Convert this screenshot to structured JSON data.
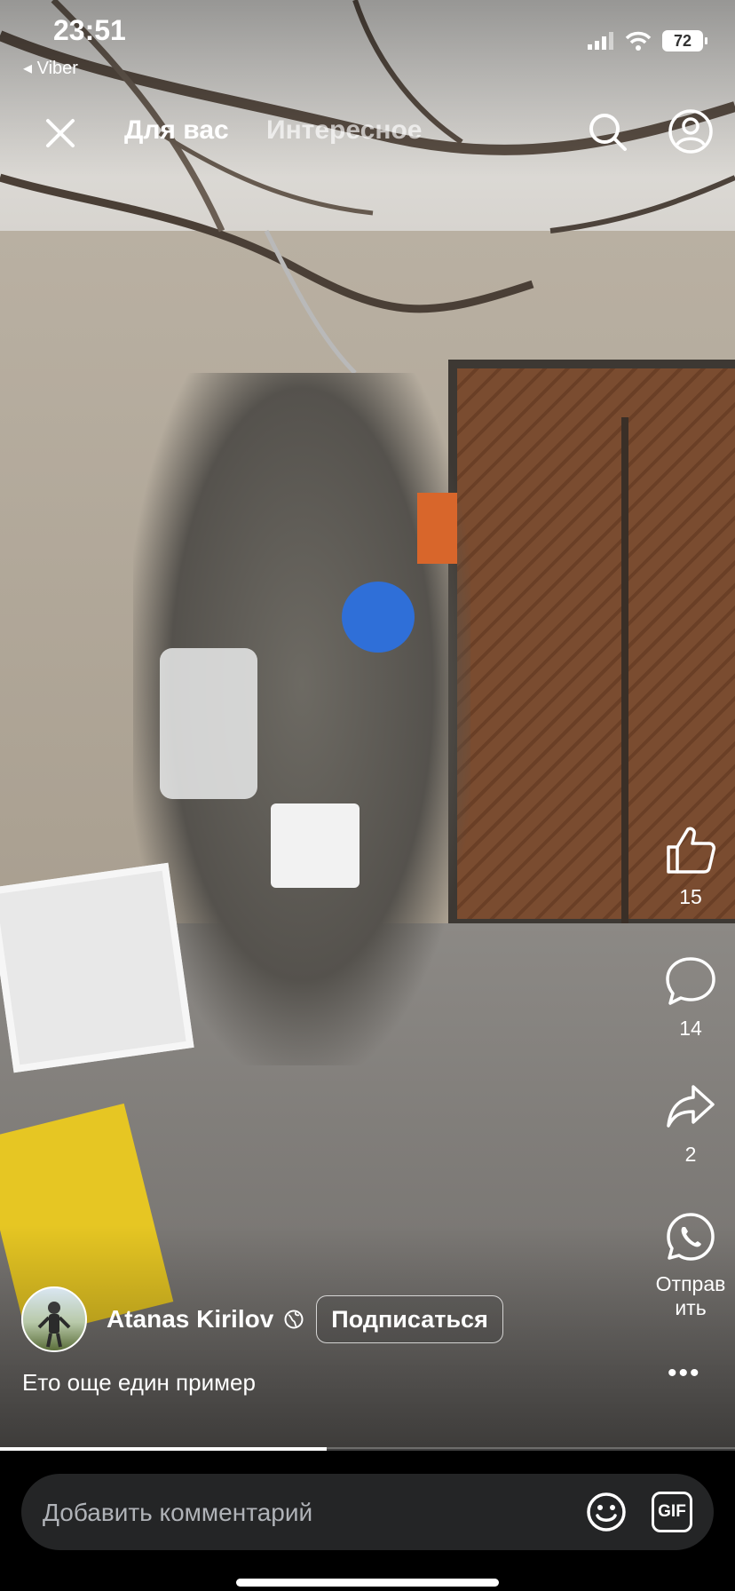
{
  "status_bar": {
    "time": "23:51",
    "back_app": "◂ Viber",
    "battery": "72"
  },
  "nav": {
    "tabs": [
      {
        "label": "Для вас",
        "active": true
      },
      {
        "label": "Интересное",
        "active": false
      }
    ]
  },
  "actions": {
    "likes": "15",
    "comments": "14",
    "shares": "2",
    "send_label_line1": "Отправ",
    "send_label_line2": "ить"
  },
  "post": {
    "author": "Atanas Kirilov",
    "subscribe_label": "Подписаться",
    "caption": "Ето още един пример",
    "more": "•••"
  },
  "video": {
    "progress": 0.445
  },
  "comment_bar": {
    "placeholder": "Добавить комментарий",
    "gif_label": "GIF"
  },
  "colors": {
    "accent": "#ffffff",
    "field_bg": "#242526"
  }
}
